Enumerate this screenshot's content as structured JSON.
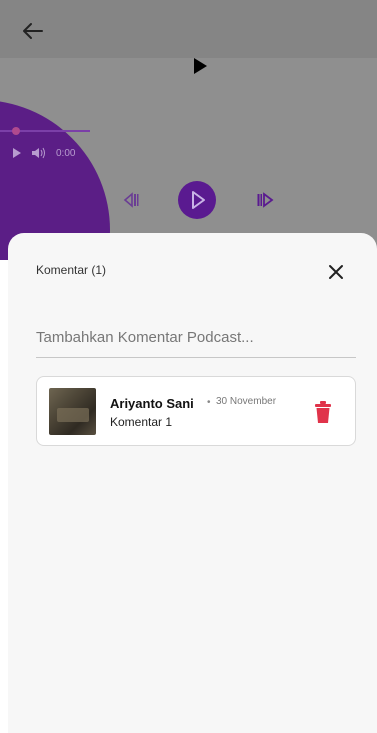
{
  "player": {
    "time_display": "0:00",
    "colors": {
      "accent": "#5a1a90",
      "dim_overlay": "#8f8f8f"
    }
  },
  "sheet": {
    "title": "Komentar (1)",
    "input_placeholder": "Tambahkan Komentar Podcast...",
    "comments": [
      {
        "author": "Ariyanto Sani",
        "separator": "•",
        "date": "30 November",
        "text": "Komentar 1"
      }
    ],
    "colors": {
      "delete": "#e0334a"
    }
  },
  "icons": {
    "back": "arrow-left-icon",
    "top_play": "play-icon",
    "prev": "skip-previous-icon",
    "play": "play-circle-icon",
    "next": "skip-next-icon",
    "close": "close-icon",
    "delete": "trash-icon"
  }
}
